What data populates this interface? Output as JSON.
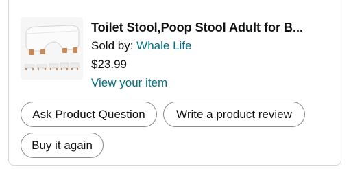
{
  "product": {
    "title": "Toilet Stool,Poop Stool Adult for B...",
    "sold_by_label": "Sold by: ",
    "seller": "Whale Life",
    "price": "$23.99",
    "view_item_label": "View your item",
    "image_icon": "toilet-stool-product-image"
  },
  "actions": {
    "ask_question": "Ask Product Question",
    "write_review": "Write a product review",
    "buy_again": "Buy it again"
  },
  "colors": {
    "link": "#007185",
    "border": "#888c8c",
    "text": "#0f1111",
    "stool_leg": "#c98a5a"
  }
}
